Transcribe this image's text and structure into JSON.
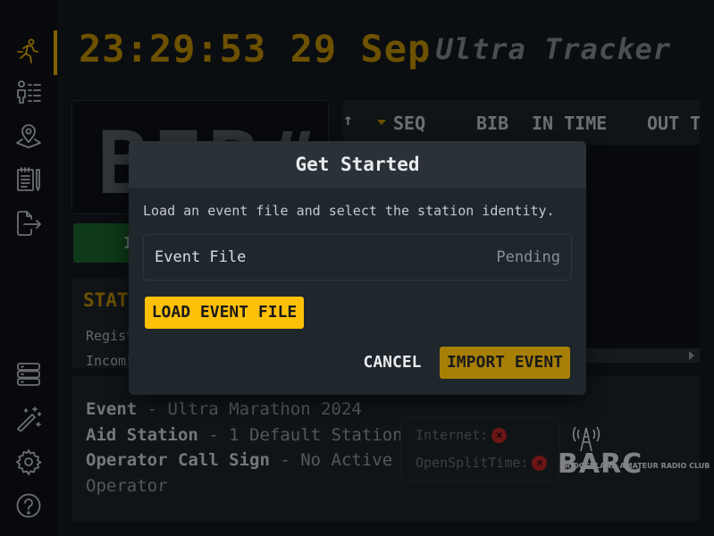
{
  "header": {
    "clock": "23:29:53 29 Sep",
    "app_title": "Ultra Tracker"
  },
  "sidebar": {
    "items": [
      {
        "icon": "runner-icon",
        "active": true
      },
      {
        "icon": "runners-list-icon",
        "active": false
      },
      {
        "icon": "location-pin-icon",
        "active": false
      },
      {
        "icon": "logbook-icon",
        "active": false
      },
      {
        "icon": "export-file-icon",
        "active": false
      },
      {
        "icon": "database-icon",
        "active": false
      },
      {
        "icon": "setup-wizard-icon",
        "active": false
      },
      {
        "icon": "settings-gear-icon",
        "active": false
      },
      {
        "icon": "help-icon",
        "active": false
      }
    ]
  },
  "bib_entry": {
    "display": "BIB#",
    "record_label": "IN"
  },
  "stats": {
    "title": "STATS",
    "rows": [
      "Regist",
      "Incomi"
    ]
  },
  "table": {
    "sort_glyph": "↑",
    "columns": [
      "SEQ",
      "BIB",
      "IN TIME",
      "OUT T"
    ]
  },
  "event_info": {
    "event_key": "Event",
    "event_value": " - Ultra Marathon 2024",
    "station_key": "Aid Station",
    "station_value": " - 1 Default Station",
    "operator_key": "Operator Call Sign",
    "operator_value": " - No Active",
    "operator_value_2": "Operator"
  },
  "connections": [
    {
      "label": "Internet:",
      "status_glyph": "×"
    },
    {
      "label": "OpenSplitTime:",
      "status_glyph": "×"
    }
  ],
  "logo": {
    "name": "BARC",
    "subtitle": "BRIDGERLAND AMATEUR RADIO CLUB"
  },
  "modal": {
    "title": "Get Started",
    "description": "Load an event file and select the station identity.",
    "event_file_label": "Event File",
    "event_file_status": "Pending",
    "load_button": "LOAD EVENT FILE",
    "cancel_button": "CANCEL",
    "import_button": "IMPORT EVENT"
  },
  "colors": {
    "accent": "#f3b300",
    "clock": "#c99700",
    "load_button": "#ffc107",
    "import_button": "#a77f05",
    "record_button": "#1b6a2d",
    "error": "#c62828"
  }
}
